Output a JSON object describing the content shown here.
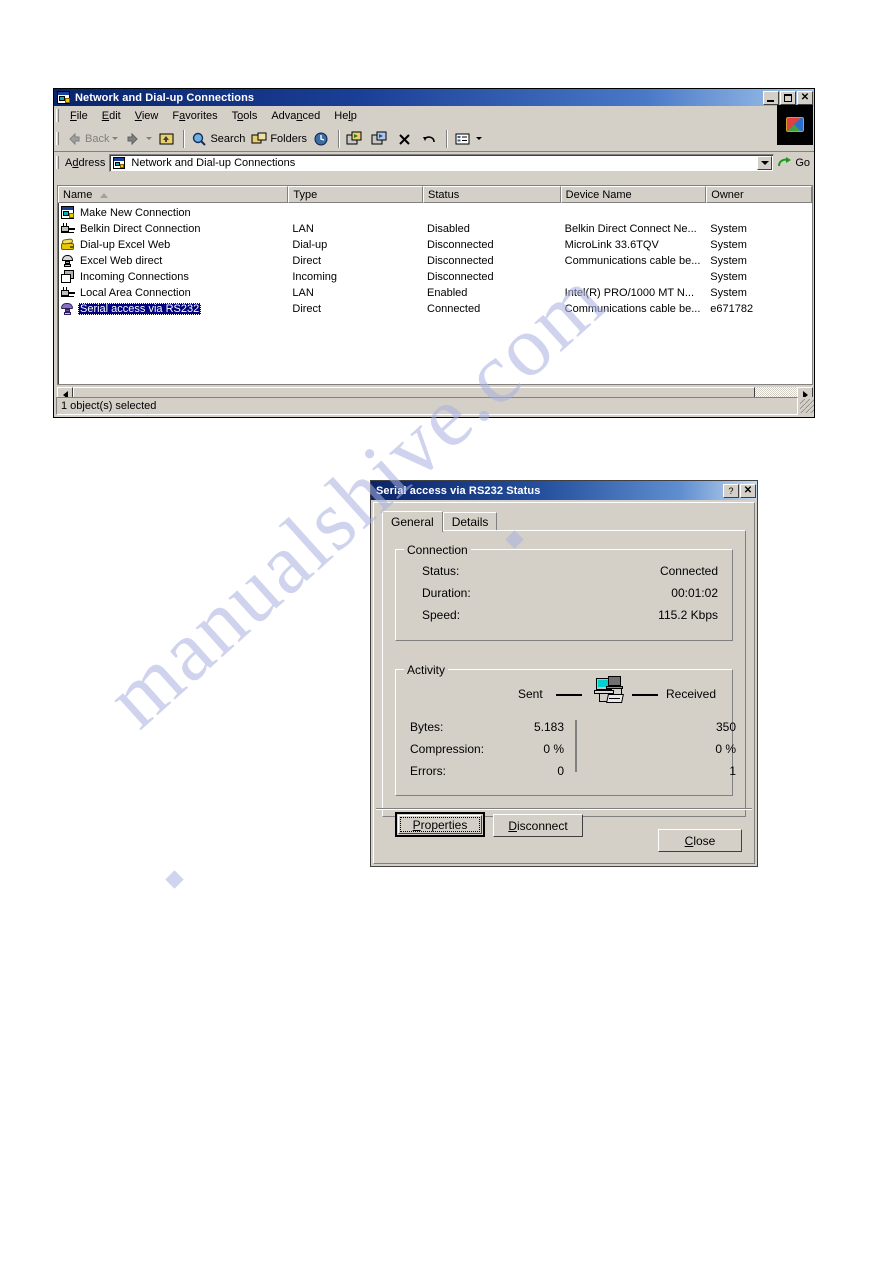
{
  "explorer": {
    "title": "Network and Dial-up Connections",
    "title_icon": "network-connections-icon",
    "window_buttons": {
      "minimize": "minimize-icon",
      "maximize": "maximize-icon",
      "close": "close-icon"
    },
    "menu": [
      {
        "label": "File",
        "accel": "F"
      },
      {
        "label": "Edit",
        "accel": "E"
      },
      {
        "label": "View",
        "accel": "V"
      },
      {
        "label": "Favorites",
        "accel": "a"
      },
      {
        "label": "Tools",
        "accel": "o"
      },
      {
        "label": "Advanced",
        "accel": "n"
      },
      {
        "label": "Help",
        "accel": "l"
      }
    ],
    "toolbar": {
      "back": "Back",
      "search": "Search",
      "folders": "Folders",
      "icons": [
        "back-arrow-icon",
        "forward-arrow-icon",
        "up-folder-icon",
        "search-icon",
        "folders-icon",
        "history-icon",
        "move-to-icon",
        "copy-to-icon",
        "delete-icon",
        "undo-icon",
        "views-icon"
      ]
    },
    "address": {
      "label": "Address",
      "value": "Network and Dial-up Connections",
      "go_label": "Go",
      "go_icon": "go-arrow-icon",
      "dropdown_icon": "chevron-down-icon"
    },
    "columns": [
      "Name",
      "Type",
      "Status",
      "Device Name",
      "Owner"
    ],
    "sort_column": "Name",
    "sort_direction": "ascending",
    "rows": [
      {
        "icon": "make-new-connection-icon",
        "name": "Make New Connection",
        "type": "",
        "status": "",
        "device": "",
        "owner": "",
        "selected": false
      },
      {
        "icon": "lan-connection-icon",
        "name": "Belkin Direct Connection",
        "type": "LAN",
        "status": "Disabled",
        "device": "Belkin Direct Connect Ne...",
        "owner": "System",
        "selected": false
      },
      {
        "icon": "dialup-connection-icon",
        "name": "Dial-up Excel Web",
        "type": "Dial-up",
        "status": "Disconnected",
        "device": "MicroLink 33.6TQV",
        "owner": "System",
        "selected": false
      },
      {
        "icon": "direct-connection-icon",
        "name": "Excel Web direct",
        "type": "Direct",
        "status": "Disconnected",
        "device": "Communications cable be...",
        "owner": "System",
        "selected": false
      },
      {
        "icon": "incoming-connections-icon",
        "name": "Incoming Connections",
        "type": "Incoming",
        "status": "Disconnected",
        "device": "",
        "owner": "System",
        "selected": false
      },
      {
        "icon": "lan-connection-icon",
        "name": "Local Area Connection",
        "type": "LAN",
        "status": "Enabled",
        "device": "Intel(R) PRO/1000 MT N...",
        "owner": "System",
        "selected": false
      },
      {
        "icon": "serial-connection-icon",
        "name": "Serial access via RS232",
        "type": "Direct",
        "status": "Connected",
        "device": "Communications cable be...",
        "owner": "e671782",
        "selected": true
      }
    ],
    "statusbar": "1 object(s) selected"
  },
  "dialog": {
    "title": "Serial access via RS232 Status",
    "help_button": "?",
    "close_button": "×",
    "tabs": [
      {
        "label": "General",
        "active": true
      },
      {
        "label": "Details",
        "active": false
      }
    ],
    "connection": {
      "group_title": "Connection",
      "rows": [
        {
          "label": "Status:",
          "value": "Connected"
        },
        {
          "label": "Duration:",
          "value": "00:01:02"
        },
        {
          "label": "Speed:",
          "value": "115.2 Kbps"
        }
      ]
    },
    "activity": {
      "group_title": "Activity",
      "sent_label": "Sent",
      "received_label": "Received",
      "icon": "two-computers-transfer-icon",
      "rows": [
        {
          "label": "Bytes:",
          "sent": "5.183",
          "received": "350"
        },
        {
          "label": "Compression:",
          "sent": "0 %",
          "received": "0 %"
        },
        {
          "label": "Errors:",
          "sent": "0",
          "received": "1"
        }
      ]
    },
    "buttons": {
      "properties": "Properties",
      "disconnect": "Disconnect",
      "close": "Close"
    }
  },
  "watermark": {
    "text": "manualshive.com"
  },
  "colors": {
    "titlebar_start": "#0a246a",
    "titlebar_end": "#a6c8ec",
    "face": "#d4d0c8",
    "selection": "#000080",
    "watermark": "#a9b0e0"
  }
}
